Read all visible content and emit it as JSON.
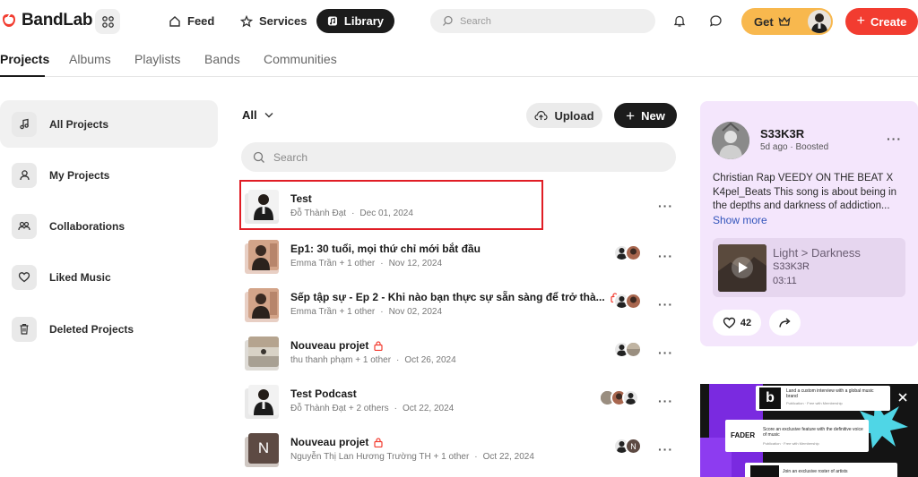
{
  "brand": {
    "name": "BandLab",
    "accent": "#f23c30"
  },
  "nav": {
    "feed": "Feed",
    "services": "Services",
    "library": "Library",
    "search_placeholder": "Search",
    "get_label": "Get",
    "create_label": "Create"
  },
  "tabs": [
    "Projects",
    "Albums",
    "Playlists",
    "Bands",
    "Communities"
  ],
  "sidebar": {
    "items": [
      {
        "label": "All Projects",
        "icon": "music-note-icon"
      },
      {
        "label": "My Projects",
        "icon": "user-icon"
      },
      {
        "label": "Collaborations",
        "icon": "users-icon"
      },
      {
        "label": "Liked Music",
        "icon": "heart-icon"
      },
      {
        "label": "Deleted Projects",
        "icon": "trash-icon"
      }
    ]
  },
  "projects": {
    "filter": "All",
    "upload_label": "Upload",
    "new_label": "New",
    "search_placeholder": "Search",
    "rows": [
      {
        "title": "Test",
        "author": "Đỗ Thành Đạt",
        "date": "Dec 01, 2024",
        "locked": false
      },
      {
        "title": "Ep1: 30 tuổi, mọi thứ chỉ mới bắt đầu",
        "author": "Emma Trần + 1 other",
        "date": "Nov 12, 2024",
        "locked": false
      },
      {
        "title": "Sếp tập sự - Ep 2 - Khi nào bạn thực sự sẵn sàng để trở thà...",
        "author": "Emma Trần + 1 other",
        "date": "Nov 02, 2024",
        "locked": true
      },
      {
        "title": "Nouveau projet",
        "author": "thu thanh phạm + 1 other",
        "date": "Oct 26, 2024",
        "locked": true
      },
      {
        "title": "Test Podcast",
        "author": "Đỗ Thành Đạt + 2 others",
        "date": "Oct 22, 2024",
        "locked": false
      },
      {
        "title": "Nouveau projet",
        "author": "Nguyễn Thị Lan Hương Trường TH + 1 other",
        "date": "Oct 22, 2024",
        "locked": true,
        "thumb_letter": "N",
        "collab_letter": "N"
      }
    ]
  },
  "post": {
    "user": "S33K3R",
    "subtitle": "5d ago · Boosted",
    "text": "Christian Rap VEEDY ON THE BEAT X K4pel_Beats This song is about being in the depths and darkness of addiction...",
    "show_more": "Show more",
    "track_title": "Light > Darkness",
    "track_artist": "S33K3R",
    "track_duration": "03:11",
    "likes": "42"
  },
  "ad": {
    "line1": "Land a custom interview with a global music brand",
    "line1_sub": "Publication · Free with Membership",
    "line2": "Score an exclusive feature with the definitive voice of music",
    "line2_sub": "Publication · Free with Membership",
    "line3": "Join an exclusive roster of artists",
    "fader": "FADER"
  }
}
